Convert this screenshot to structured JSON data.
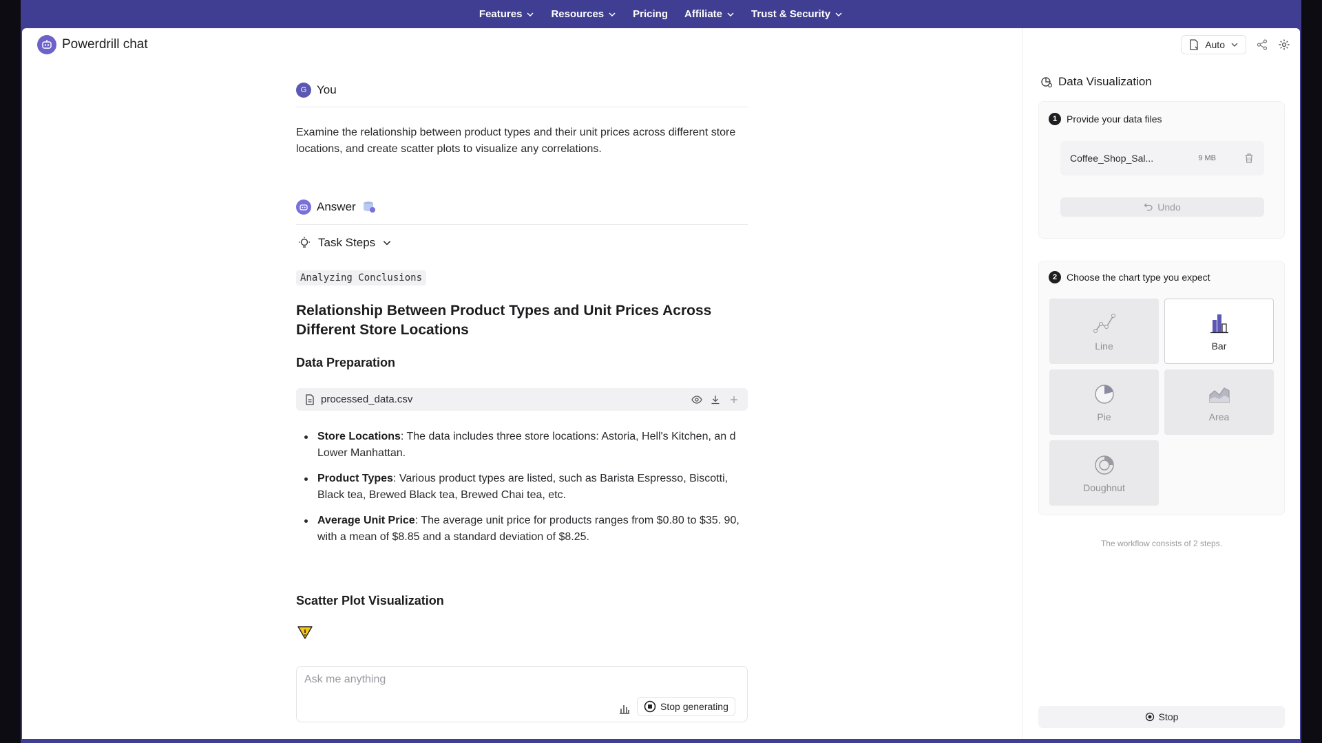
{
  "nav": {
    "items": [
      {
        "label": "Features",
        "has_menu": true
      },
      {
        "label": "Resources",
        "has_menu": true
      },
      {
        "label": "Pricing",
        "has_menu": false
      },
      {
        "label": "Affiliate",
        "has_menu": true
      },
      {
        "label": "Trust & Security",
        "has_menu": true
      }
    ]
  },
  "app": {
    "name": "Powerdrill chat"
  },
  "chat": {
    "user": {
      "avatar_letter": "G",
      "name": "You",
      "text": "Examine the relationship between product types and their unit prices across different store locations, and create scatter plots to visualize any correlations."
    },
    "answer": {
      "name": "Answer",
      "task_steps_label": "Task Steps",
      "status_tag": "Analyzing Conclusions",
      "heading": "Relationship Between Product Types and Unit Prices Across Different Store Locations",
      "section1": "Data Preparation",
      "file_name": "processed_data.csv",
      "bullets": [
        {
          "term": "Store Locations",
          "text": ": The data includes three store locations: Astoria, Hell's Kitchen, an d Lower Manhattan."
        },
        {
          "term": "Product Types",
          "text": ": Various product types are listed, such as Barista Espresso, Biscotti, Black tea, Brewed Black tea, Brewed Chai tea, etc."
        },
        {
          "term": "Average Unit Price",
          "text": ": The average unit price for products ranges from $0.80 to $35. 90, with a mean of $8.85 and a standard deviation of $8.25."
        }
      ],
      "section2": "Scatter Plot Visualization"
    },
    "input": {
      "placeholder": "Ask me anything",
      "value": "",
      "stop_label": "Stop generating"
    }
  },
  "panel": {
    "mode": "Auto",
    "title": "Data Visualization",
    "step1": {
      "num": "1",
      "label": "Provide your data files",
      "file_name": "Coffee_Shop_Sal...",
      "file_size": "9 MB",
      "undo_label": "Undo"
    },
    "step2": {
      "num": "2",
      "label": "Choose the chart type you expect",
      "options": [
        {
          "label": "Line",
          "selected": false
        },
        {
          "label": "Bar",
          "selected": true
        },
        {
          "label": "Pie",
          "selected": false
        },
        {
          "label": "Area",
          "selected": false
        },
        {
          "label": "Doughnut",
          "selected": false
        }
      ]
    },
    "note": "The workflow consists of 2 steps.",
    "stop_label": "Stop"
  },
  "colors": {
    "brand": "#403e92",
    "accent": "#6d62c9",
    "selected_bar": "#5b57b3"
  }
}
